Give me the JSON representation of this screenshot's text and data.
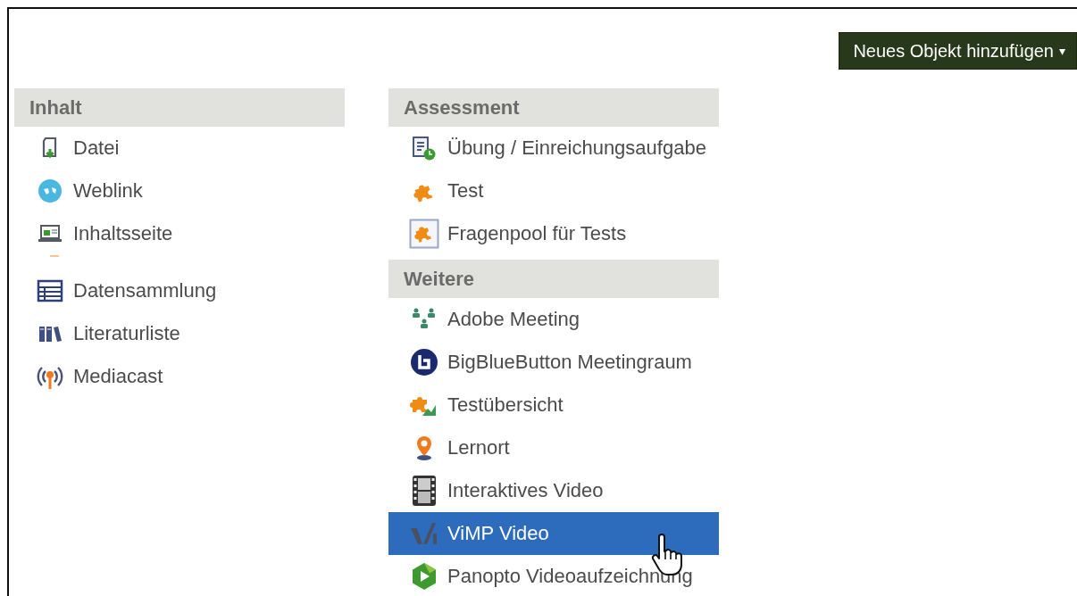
{
  "add_button": {
    "label": "Neues Objekt hinzufügen",
    "caret": "▾"
  },
  "columns": [
    {
      "groups": [
        {
          "title": "Inhalt",
          "items": [
            {
              "kind": "item",
              "label": "Datei",
              "selected": false
            },
            {
              "kind": "item",
              "label": "Weblink",
              "selected": false
            },
            {
              "kind": "item",
              "label": "Inhaltsseite",
              "selected": false
            },
            {
              "kind": "spacer"
            },
            {
              "kind": "item",
              "label": "Datensammlung",
              "selected": false
            },
            {
              "kind": "item",
              "label": "Literaturliste",
              "selected": false
            },
            {
              "kind": "item",
              "label": "Mediacast",
              "selected": false
            }
          ]
        }
      ]
    },
    {
      "groups": [
        {
          "title": "Assessment",
          "items": [
            {
              "kind": "item",
              "label": "Übung / Einreichungsaufgabe",
              "selected": false
            },
            {
              "kind": "item",
              "label": "Test",
              "selected": false
            },
            {
              "kind": "item",
              "label": "Fragenpool für Tests",
              "selected": false
            }
          ]
        },
        {
          "title": "Weitere",
          "items": [
            {
              "kind": "item",
              "label": "Adobe Meeting",
              "selected": false
            },
            {
              "kind": "item",
              "label": "BigBlueButton Meetingraum",
              "selected": false
            },
            {
              "kind": "item",
              "label": "Testübersicht",
              "selected": false
            },
            {
              "kind": "item",
              "label": "Lernort",
              "selected": false
            },
            {
              "kind": "item",
              "label": "Interaktives Video",
              "selected": false
            },
            {
              "kind": "item",
              "label": "ViMP Video",
              "selected": true
            },
            {
              "kind": "item",
              "label": "Panopto Videoaufzeichnung",
              "selected": false
            }
          ]
        }
      ]
    }
  ]
}
